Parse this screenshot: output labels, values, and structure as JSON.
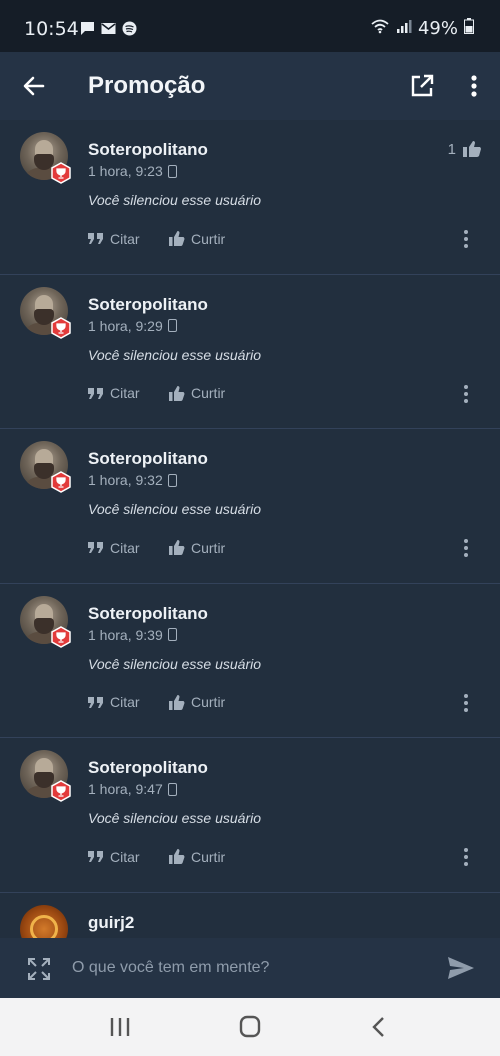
{
  "status_bar": {
    "time": "10:54",
    "battery": "49%",
    "left_icons": [
      "chat-icon",
      "mail-icon",
      "spotify-icon"
    ],
    "right_icons": [
      "wifi-icon",
      "signal-icon",
      "battery-icon"
    ]
  },
  "app_bar": {
    "title": "Promoção",
    "back_icon": "arrow-left-icon",
    "open_external_icon": "open-external-icon",
    "menu_icon": "more-vertical-icon"
  },
  "posts": [
    {
      "author": "Soteropolitano",
      "time": "1 hora, 9:23",
      "content": "Você silenciou esse usuário",
      "likes": "1",
      "quote_label": "Citar",
      "like_label": "Curtir"
    },
    {
      "author": "Soteropolitano",
      "time": "1 hora, 9:29",
      "content": "Você silenciou esse usuário",
      "quote_label": "Citar",
      "like_label": "Curtir"
    },
    {
      "author": "Soteropolitano",
      "time": "1 hora, 9:32",
      "content": "Você silenciou esse usuário",
      "quote_label": "Citar",
      "like_label": "Curtir"
    },
    {
      "author": "Soteropolitano",
      "time": "1 hora, 9:39",
      "content": "Você silenciou esse usuário",
      "quote_label": "Citar",
      "like_label": "Curtir"
    },
    {
      "author": "Soteropolitano",
      "time": "1 hora, 9:47",
      "content": "Você silenciou esse usuário",
      "quote_label": "Citar",
      "like_label": "Curtir"
    }
  ],
  "partial_post": {
    "author": "guirj2"
  },
  "composer": {
    "placeholder": "O que você tem em mente?"
  },
  "colors": {
    "background": "#222f3e",
    "app_bar": "#253345",
    "badge": "#e23b3b",
    "secondary_text": "#a4b0bd"
  }
}
